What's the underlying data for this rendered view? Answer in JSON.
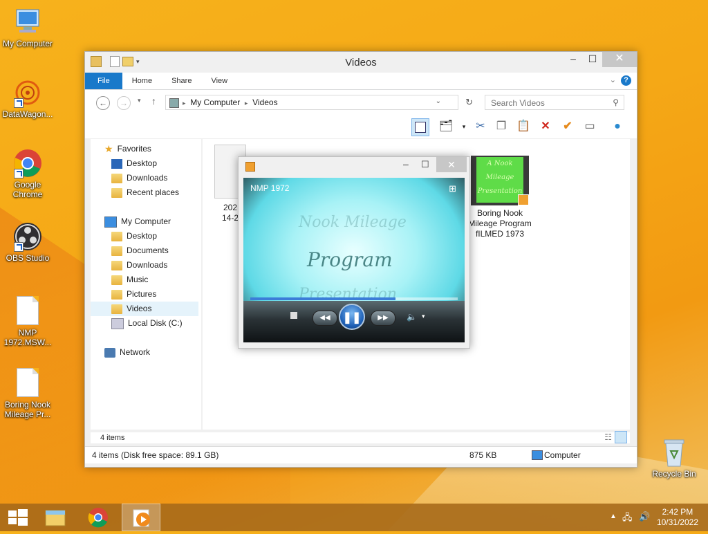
{
  "desktop": {
    "icons": [
      {
        "label": "My Computer"
      },
      {
        "label": "DataWagon..."
      },
      {
        "label": "Google Chrome"
      },
      {
        "label": "OBS Studio"
      },
      {
        "label": "NMP 1972.MSW..."
      },
      {
        "label": "Boring Nook Mileage Pr..."
      },
      {
        "label": "Recycle Bin"
      }
    ]
  },
  "explorer": {
    "title": "Videos",
    "tabs": [
      "File",
      "Home",
      "Share",
      "View"
    ],
    "address": {
      "crumbs": [
        "My Computer",
        "Videos"
      ]
    },
    "search_placeholder": "Search Videos",
    "nav": {
      "favorites": "Favorites",
      "favorites_items": [
        "Desktop",
        "Downloads",
        "Recent places"
      ],
      "computer": "My Computer",
      "computer_items": [
        "Desktop",
        "Documents",
        "Downloads",
        "Music",
        "Pictures",
        "Videos",
        "Local Disk (C:)"
      ],
      "network": "Network"
    },
    "files": [
      {
        "name_line1": "202",
        "name_line2": "14-2"
      },
      {
        "name": "Boring Nook Mileage Program fILMED 1973",
        "thumb_text": "A Nook Mileage Presentation"
      }
    ],
    "item_count": "4 items",
    "status": {
      "left": "4 items (Disk free space: 89.1 GB)",
      "size": "875 KB",
      "location": "Computer"
    }
  },
  "player": {
    "video_title": "NMP 1972",
    "video_lines": [
      "Nook Mileage",
      "Program",
      "Presentation"
    ],
    "progress": 0.7
  },
  "taskbar": {
    "time": "2:42 PM",
    "date": "10/31/2022"
  },
  "colors": {
    "accent": "#1979ca",
    "desktop": "#f5a816"
  }
}
